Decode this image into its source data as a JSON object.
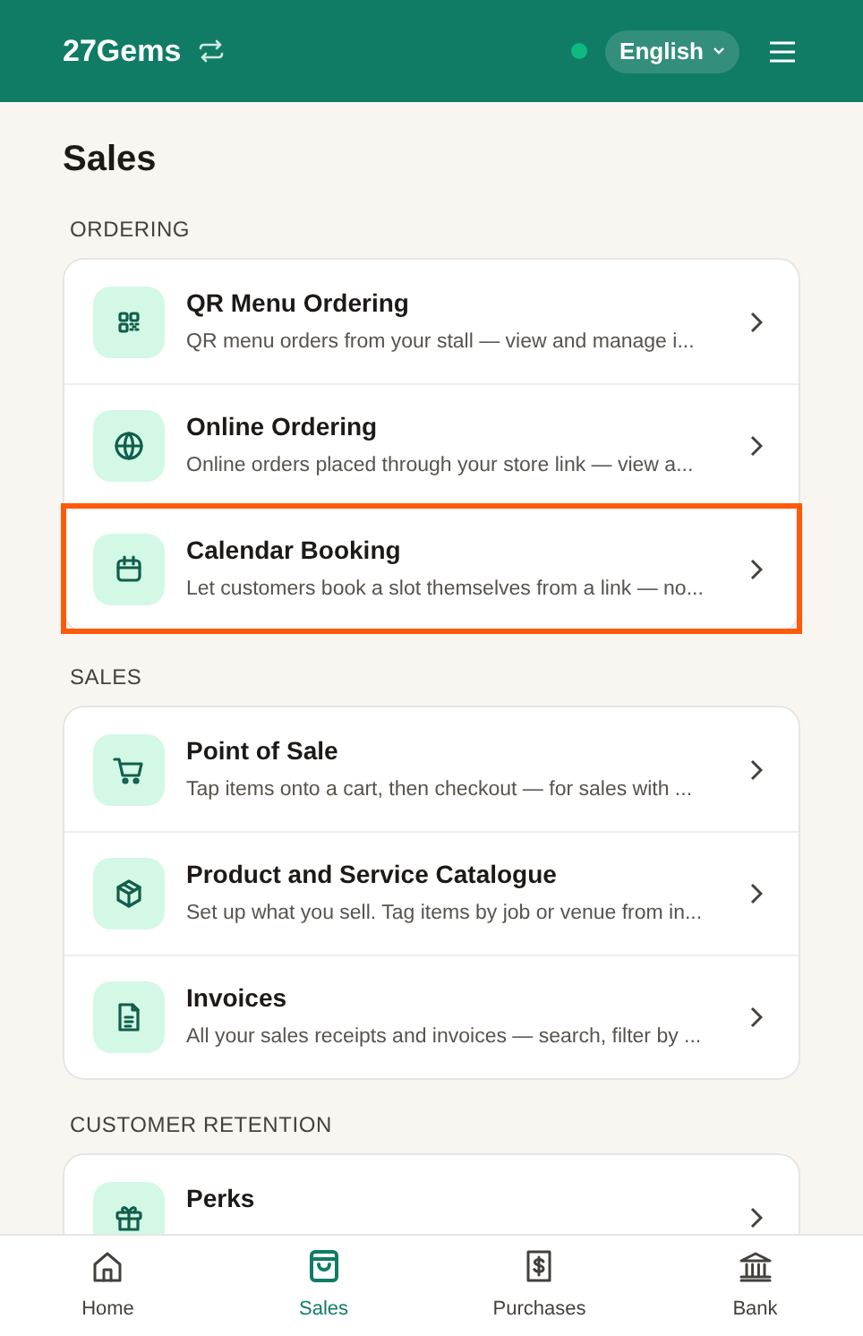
{
  "header": {
    "brand": "27Gems",
    "online": true,
    "language": "English"
  },
  "page_title": "Sales",
  "sections": [
    {
      "title": "ORDERING",
      "items": [
        {
          "kind": "qr",
          "title": "QR Menu Ordering",
          "description": "QR menu orders from your stall — view and manage i...",
          "highlighted": false
        },
        {
          "kind": "globe",
          "title": "Online Ordering",
          "description": "Online orders placed through your store link — view a...",
          "highlighted": false
        },
        {
          "kind": "calendar",
          "title": "Calendar Booking",
          "description": "Let customers book a slot themselves from a link — no...",
          "highlighted": true
        }
      ]
    },
    {
      "title": "SALES",
      "items": [
        {
          "kind": "cart",
          "title": "Point of Sale",
          "description": "Tap items onto a cart, then checkout — for sales with ...",
          "highlighted": false
        },
        {
          "kind": "box",
          "title": "Product and Service Catalogue",
          "description": "Set up what you sell. Tag items by job or venue from in...",
          "highlighted": false
        },
        {
          "kind": "doc",
          "title": "Invoices",
          "description": "All your sales receipts and invoices — search, filter by ...",
          "highlighted": false
        }
      ]
    },
    {
      "title": "CUSTOMER RETENTION",
      "items": [
        {
          "kind": "gift",
          "title": "Perks",
          "highlighted": false
        }
      ]
    }
  ],
  "bottom_nav": [
    {
      "kind": "home",
      "label": "Home",
      "selected": false
    },
    {
      "kind": "bag",
      "label": "Sales",
      "selected": true
    },
    {
      "kind": "receipt",
      "label": "Purchases",
      "selected": false
    },
    {
      "kind": "bank",
      "label": "Bank",
      "selected": false
    }
  ]
}
